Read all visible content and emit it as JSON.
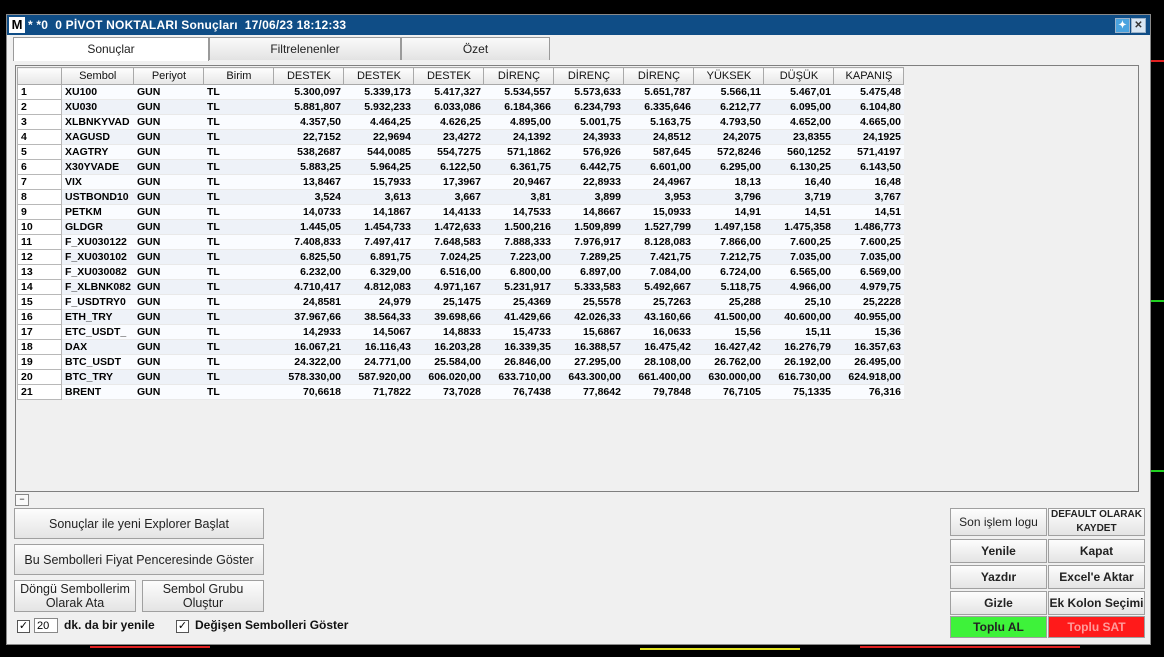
{
  "window": {
    "logo": "M",
    "title": "* *0  0 PİVOT NOKTALARI Sonuçları  17/06/23 18:12:33",
    "twitter_icon": "twitter-icon",
    "close_icon": "close-icon"
  },
  "tabs": [
    {
      "label": "Sonuçlar",
      "active": true
    },
    {
      "label": "Filtrelenenler",
      "active": false
    },
    {
      "label": "Özet",
      "active": false
    }
  ],
  "table": {
    "headers": [
      "",
      "Sembol",
      "Periyot",
      "Birim",
      "DESTEK",
      "DESTEK",
      "DESTEK",
      "DİRENÇ",
      "DİRENÇ",
      "DİRENÇ",
      "YÜKSEK",
      "DÜŞÜK",
      "KAPANIŞ"
    ],
    "rows": [
      [
        "1",
        "XU100",
        "GUN",
        "TL",
        "5.300,097",
        "5.339,173",
        "5.417,327",
        "5.534,557",
        "5.573,633",
        "5.651,787",
        "5.566,11",
        "5.467,01",
        "5.475,48"
      ],
      [
        "2",
        "XU030",
        "GUN",
        "TL",
        "5.881,807",
        "5.932,233",
        "6.033,086",
        "6.184,366",
        "6.234,793",
        "6.335,646",
        "6.212,77",
        "6.095,00",
        "6.104,80"
      ],
      [
        "3",
        "XLBNKYVAD",
        "GUN",
        "TL",
        "4.357,50",
        "4.464,25",
        "4.626,25",
        "4.895,00",
        "5.001,75",
        "5.163,75",
        "4.793,50",
        "4.652,00",
        "4.665,00"
      ],
      [
        "4",
        "XAGUSD",
        "GUN",
        "TL",
        "22,7152",
        "22,9694",
        "23,4272",
        "24,1392",
        "24,3933",
        "24,8512",
        "24,2075",
        "23,8355",
        "24,1925"
      ],
      [
        "5",
        "XAGTRY",
        "GUN",
        "TL",
        "538,2687",
        "544,0085",
        "554,7275",
        "571,1862",
        "576,926",
        "587,645",
        "572,8246",
        "560,1252",
        "571,4197"
      ],
      [
        "6",
        "X30YVADE",
        "GUN",
        "TL",
        "5.883,25",
        "5.964,25",
        "6.122,50",
        "6.361,75",
        "6.442,75",
        "6.601,00",
        "6.295,00",
        "6.130,25",
        "6.143,50"
      ],
      [
        "7",
        "VIX",
        "GUN",
        "TL",
        "13,8467",
        "15,7933",
        "17,3967",
        "20,9467",
        "22,8933",
        "24,4967",
        "18,13",
        "16,40",
        "16,48"
      ],
      [
        "8",
        "USTBOND10",
        "GUN",
        "TL",
        "3,524",
        "3,613",
        "3,667",
        "3,81",
        "3,899",
        "3,953",
        "3,796",
        "3,719",
        "3,767"
      ],
      [
        "9",
        "PETKM",
        "GUN",
        "TL",
        "14,0733",
        "14,1867",
        "14,4133",
        "14,7533",
        "14,8667",
        "15,0933",
        "14,91",
        "14,51",
        "14,51"
      ],
      [
        "10",
        "GLDGR",
        "GUN",
        "TL",
        "1.445,05",
        "1.454,733",
        "1.472,633",
        "1.500,216",
        "1.509,899",
        "1.527,799",
        "1.497,158",
        "1.475,358",
        "1.486,773"
      ],
      [
        "11",
        "F_XU030122",
        "GUN",
        "TL",
        "7.408,833",
        "7.497,417",
        "7.648,583",
        "7.888,333",
        "7.976,917",
        "8.128,083",
        "7.866,00",
        "7.600,25",
        "7.600,25"
      ],
      [
        "12",
        "F_XU030102",
        "GUN",
        "TL",
        "6.825,50",
        "6.891,75",
        "7.024,25",
        "7.223,00",
        "7.289,25",
        "7.421,75",
        "7.212,75",
        "7.035,00",
        "7.035,00"
      ],
      [
        "13",
        "F_XU030082",
        "GUN",
        "TL",
        "6.232,00",
        "6.329,00",
        "6.516,00",
        "6.800,00",
        "6.897,00",
        "7.084,00",
        "6.724,00",
        "6.565,00",
        "6.569,00"
      ],
      [
        "14",
        "F_XLBNK082",
        "GUN",
        "TL",
        "4.710,417",
        "4.812,083",
        "4.971,167",
        "5.231,917",
        "5.333,583",
        "5.492,667",
        "5.118,75",
        "4.966,00",
        "4.979,75"
      ],
      [
        "15",
        "F_USDTRY0",
        "GUN",
        "TL",
        "24,8581",
        "24,979",
        "25,1475",
        "25,4369",
        "25,5578",
        "25,7263",
        "25,288",
        "25,10",
        "25,2228"
      ],
      [
        "16",
        "ETH_TRY",
        "GUN",
        "TL",
        "37.967,66",
        "38.564,33",
        "39.698,66",
        "41.429,66",
        "42.026,33",
        "43.160,66",
        "41.500,00",
        "40.600,00",
        "40.955,00"
      ],
      [
        "17",
        "ETC_USDT_",
        "GUN",
        "TL",
        "14,2933",
        "14,5067",
        "14,8833",
        "15,4733",
        "15,6867",
        "16,0633",
        "15,56",
        "15,11",
        "15,36"
      ],
      [
        "18",
        "DAX",
        "GUN",
        "TL",
        "16.067,21",
        "16.116,43",
        "16.203,28",
        "16.339,35",
        "16.388,57",
        "16.475,42",
        "16.427,42",
        "16.276,79",
        "16.357,63"
      ],
      [
        "19",
        "BTC_USDT",
        "GUN",
        "TL",
        "24.322,00",
        "24.771,00",
        "25.584,00",
        "26.846,00",
        "27.295,00",
        "28.108,00",
        "26.762,00",
        "26.192,00",
        "26.495,00"
      ],
      [
        "20",
        "BTC_TRY",
        "GUN",
        "TL",
        "578.330,00",
        "587.920,00",
        "606.020,00",
        "633.710,00",
        "643.300,00",
        "661.400,00",
        "630.000,00",
        "616.730,00",
        "624.918,00"
      ],
      [
        "21",
        "BRENT",
        "GUN",
        "TL",
        "70,6618",
        "71,7822",
        "73,7028",
        "76,7438",
        "77,8642",
        "79,7848",
        "76,7105",
        "75,1335",
        "76,316"
      ]
    ]
  },
  "left_buttons": {
    "explorer": "Sonuçlar ile yeni Explorer Başlat",
    "show_in_price": "Bu Sembolleri Fiyat Penceresinde Göster",
    "loop_assign": "Döngü Sembollerim Olarak Ata",
    "create_group": "Sembol Grubu Oluştur"
  },
  "options": {
    "refresh_checked": true,
    "refresh_minutes": "20",
    "refresh_label": "dk. da bir yenile",
    "show_changed_checked": true,
    "show_changed_label": "Değişen Sembolleri Göster"
  },
  "right_buttons": {
    "log": "Son işlem logu",
    "default_save": "DEFAULT OLARAK KAYDET",
    "refresh": "Yenile",
    "close": "Kapat",
    "print": "Yazdır",
    "excel": "Excel'e Aktar",
    "hide": "Gizle",
    "extra_columns": "Ek Kolon Seçimi",
    "buy_all": "Toplu AL",
    "sell_all": "Toplu SAT"
  },
  "colors": {
    "titlebar": "#0f4d86",
    "buy": "#3ef23a",
    "sell": "#ff1a1a"
  }
}
